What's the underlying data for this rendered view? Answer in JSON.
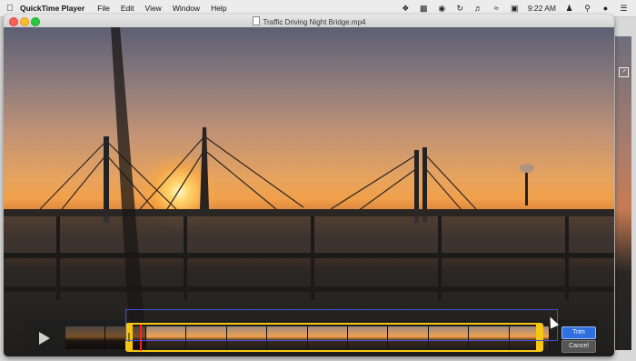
{
  "menubar": {
    "app_name": "QuickTime Player",
    "items": [
      "File",
      "Edit",
      "View",
      "Window",
      "Help"
    ],
    "clock": "9:22 AM",
    "status_icons": [
      "dropbox-icon",
      "airplay-screen-icon",
      "firefox-icon",
      "time-machine-icon",
      "volume-icon",
      "wifi-icon",
      "display-icon",
      "user-icon",
      "search-icon",
      "siri-icon",
      "control-center-icon"
    ]
  },
  "window": {
    "title": "Traffic Driving Night Bridge.mp4"
  },
  "trim": {
    "trim_label": "Trim",
    "cancel_label": "Cancel",
    "frame_count": 12
  },
  "colors": {
    "selection": "#f6c611",
    "trim_button": "#2f6fe0",
    "highlight": "#3f52d8"
  }
}
